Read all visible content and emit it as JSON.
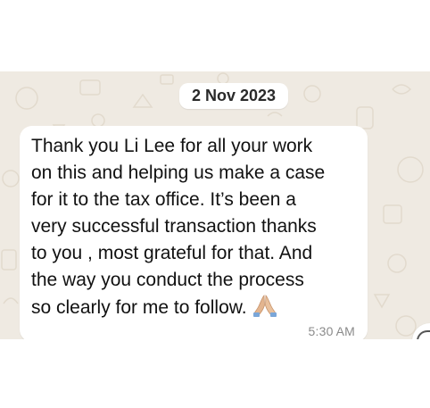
{
  "chat": {
    "date_chip": "2 Nov 2023",
    "message": {
      "lines": [
        "Thank you Li Lee for all your work",
        "on this and helping us make a case",
        "for it to the tax office. It’s been a",
        "very successful transaction thanks",
        "to you , most grateful for that. And",
        "the way you conduct the process",
        "so clearly for me to follow."
      ],
      "emoji": "folded-hands-icon",
      "time": "5:30 AM"
    }
  },
  "colors": {
    "wallpaper": "#efeae2",
    "bubble": "#ffffff",
    "text": "#111111",
    "timestamp": "#8a8a8a"
  }
}
